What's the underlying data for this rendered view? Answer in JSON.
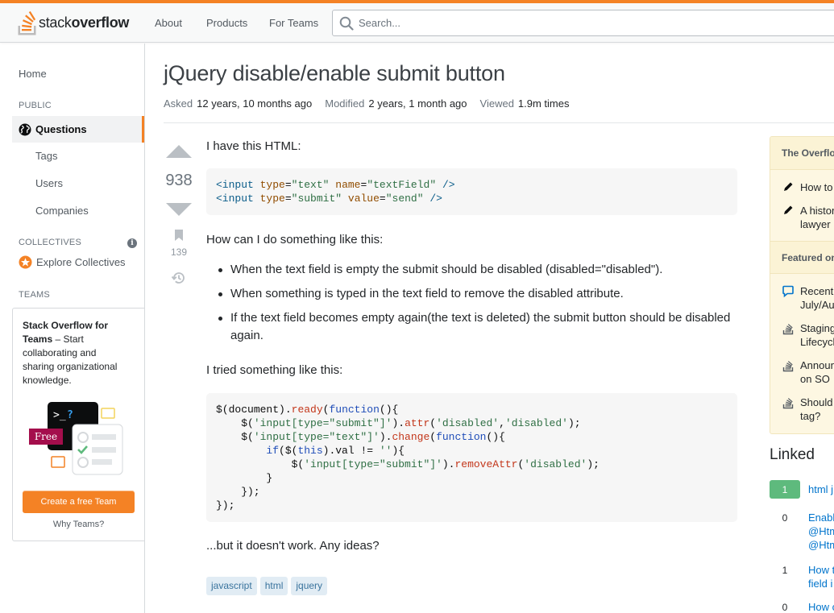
{
  "header": {
    "logo_text_light": "stack",
    "logo_text_bold": "overflow",
    "nav": [
      "About",
      "Products",
      "For Teams"
    ],
    "search_placeholder": "Search...",
    "accent_color": "#f48225"
  },
  "sidebar": {
    "home": "Home",
    "public_heading": "PUBLIC",
    "questions": "Questions",
    "items": [
      "Tags",
      "Users",
      "Companies"
    ],
    "collectives_heading": "COLLECTIVES",
    "explore_collectives": "Explore Collectives",
    "teams_heading": "TEAMS",
    "teams_title": "Stack Overflow for Teams",
    "teams_desc": "– Start collaborating and sharing organizational knowledge.",
    "free_badge": "Free",
    "create_team_button": "Create a free Team",
    "why_teams": "Why Teams?"
  },
  "question": {
    "title": "jQuery disable/enable submit button",
    "asked_label": "Asked",
    "asked_value": "12 years, 10 months ago",
    "modified_label": "Modified",
    "modified_value": "2 years, 1 month ago",
    "viewed_label": "Viewed",
    "viewed_value": "1.9m times",
    "votes": "938",
    "bookmarks": "139",
    "intro": "I have this HTML:",
    "question_line": "How can I do something like this:",
    "bullets": [
      "When the text field is empty the submit should be disabled (disabled=\"disabled\").",
      "When something is typed in the text field to remove the disabled attribute.",
      "If the text field becomes empty again(the text is deleted) the submit button should be disabled again."
    ],
    "tried": "I tried something like this:",
    "outro": "...but it doesn't work. Any ideas?",
    "tags": [
      "javascript",
      "html",
      "jquery"
    ]
  },
  "right": {
    "blog_heading": "The Overflow Blog",
    "blog_items": [
      "How to",
      "A history",
      "lawyer"
    ],
    "featured_heading": "Featured on Meta",
    "featured_items": [
      [
        "Recent",
        "July/Au"
      ],
      [
        "Staging",
        "Lifecycl"
      ],
      [
        "Announ",
        "on SO"
      ],
      [
        "Should",
        "tag?"
      ]
    ],
    "linked_heading": "Linked",
    "linked": [
      {
        "score": "1",
        "lines": [
          "html j"
        ]
      },
      {
        "score": "0",
        "lines": [
          "Enable",
          "@Htm",
          "@Htm"
        ]
      },
      {
        "score": "1",
        "lines": [
          "How t",
          "field i"
        ]
      },
      {
        "score": "0",
        "lines": [
          "How c"
        ]
      }
    ]
  }
}
